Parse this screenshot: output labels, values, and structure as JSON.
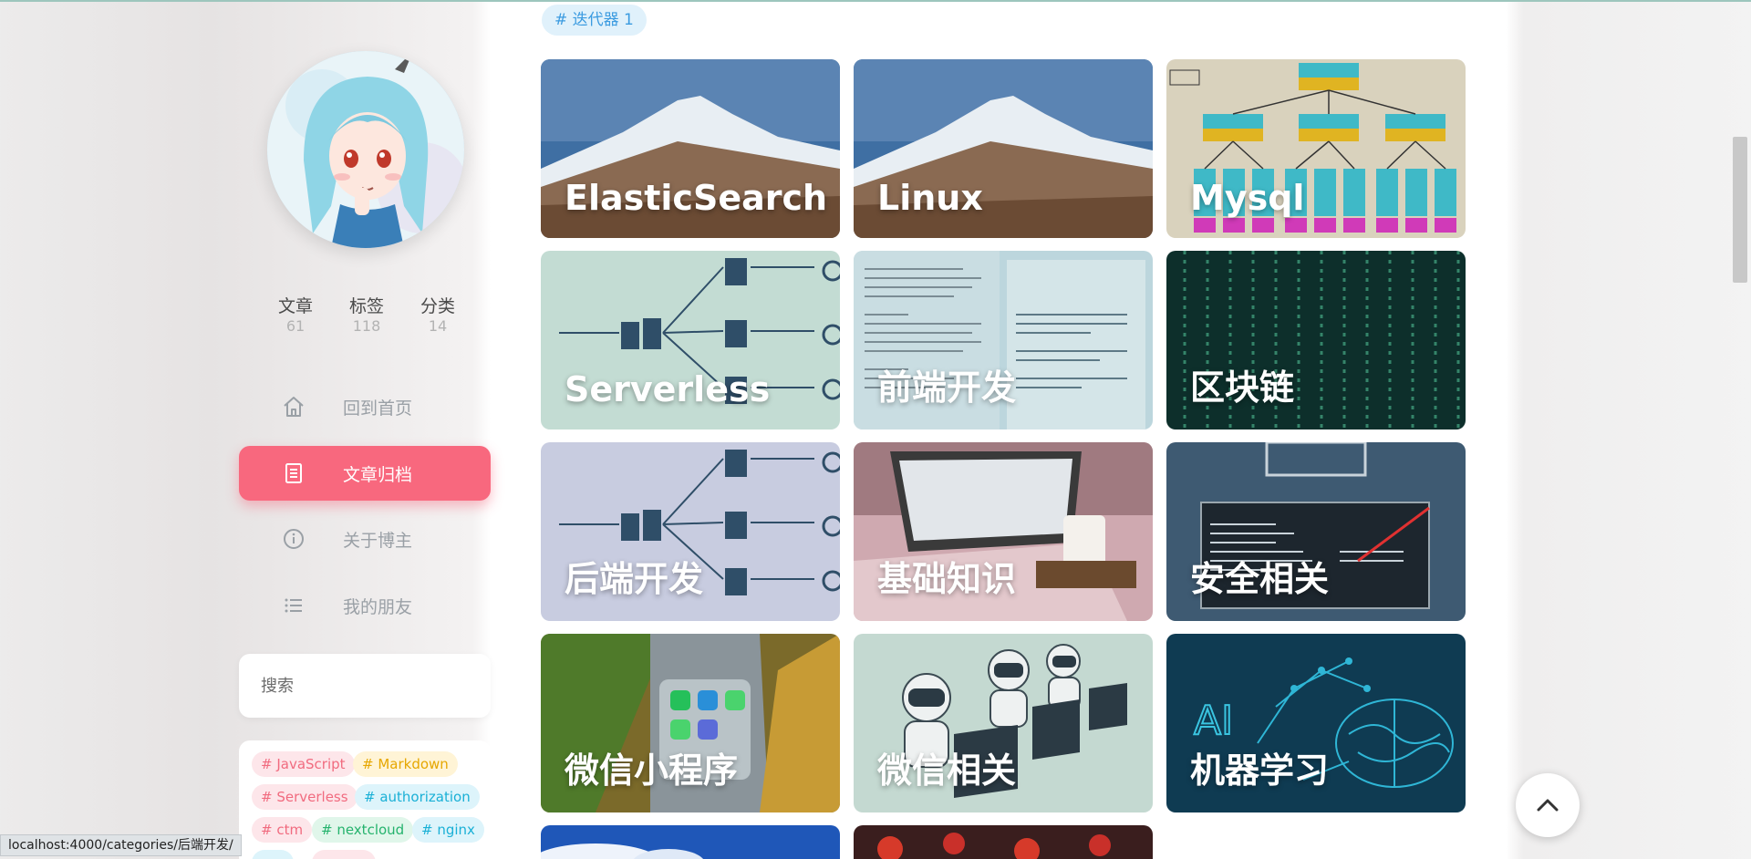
{
  "profile": {
    "stats": [
      {
        "label": "文章",
        "value": "61"
      },
      {
        "label": "标签",
        "value": "118"
      },
      {
        "label": "分类",
        "value": "14"
      }
    ]
  },
  "menu": [
    {
      "label": "回到首页",
      "icon": "home-icon",
      "active": false
    },
    {
      "label": "文章归档",
      "icon": "archive-icon",
      "active": true
    },
    {
      "label": "关于博主",
      "icon": "info-icon",
      "active": false
    },
    {
      "label": "我的朋友",
      "icon": "list-icon",
      "active": false
    }
  ],
  "search": {
    "placeholder": "搜索"
  },
  "tags": [
    {
      "label": "# JavaScript",
      "color": "#f16b7f",
      "bg": "#fde6ea"
    },
    {
      "label": "# Markdown",
      "color": "#e6a700",
      "bg": "#fff4d6"
    },
    {
      "label": "# Serverless",
      "color": "#f16b7f",
      "bg": "#fde6ea"
    },
    {
      "label": "# authorization",
      "color": "#1ab0d6",
      "bg": "#ddf4fb"
    },
    {
      "label": "# ctm",
      "color": "#f16b7f",
      "bg": "#fde6ea"
    },
    {
      "label": "# nextcloud",
      "color": "#25b36d",
      "bg": "#e0f6ea"
    },
    {
      "label": "# nginx",
      "color": "#1ab0d6",
      "bg": "#ddf4fb"
    }
  ],
  "badge": "# 迭代器 1",
  "categories": [
    "ElasticSearch",
    "Linux",
    "Mysql",
    "Serverless",
    "前端开发",
    "区块链",
    "后端开发",
    "基础知识",
    "安全相关",
    "微信小程序",
    "微信相关",
    "机器学习"
  ],
  "statusbar": "localhost:4000/categories/后端开发/",
  "colors": {
    "accent": "#f8687e",
    "badge_text": "#3b9be0"
  }
}
